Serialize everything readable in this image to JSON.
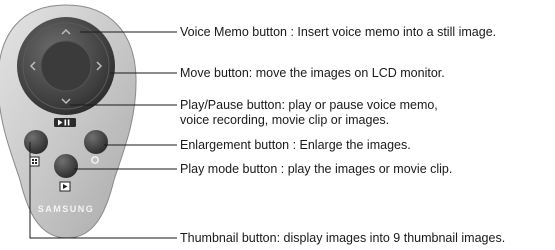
{
  "remote": {
    "brand_logo": "SAMSUNG",
    "icons": {
      "play_pause": "play-pause-icon",
      "thumbnail": "thumbnail-grid-icon",
      "play_mode": "play-mode-icon",
      "enlargement": "magnify-icon",
      "voice_memo": "voice-memo-arrow-icon"
    },
    "colors": {
      "body": "#c9c9c9",
      "body_edge": "#8a8a8a",
      "button": "#454545",
      "label_text": "#1a1a1a",
      "leader_line": "#1a1a1a"
    }
  },
  "callouts": [
    {
      "id": "voice-memo",
      "text": "Voice Memo button : Insert voice memo into a still image."
    },
    {
      "id": "move",
      "text": "Move button: move the images on LCD monitor."
    },
    {
      "id": "play-pause",
      "text": "Play/Pause button: play or pause voice memo,\nvoice recording, movie clip or images."
    },
    {
      "id": "enlargement",
      "text": "Enlargement button : Enlarge the images."
    },
    {
      "id": "play-mode",
      "text": "Play mode button : play the images or movie clip."
    },
    {
      "id": "thumbnail",
      "text": "Thumbnail button: display images into 9 thumbnail images."
    }
  ]
}
